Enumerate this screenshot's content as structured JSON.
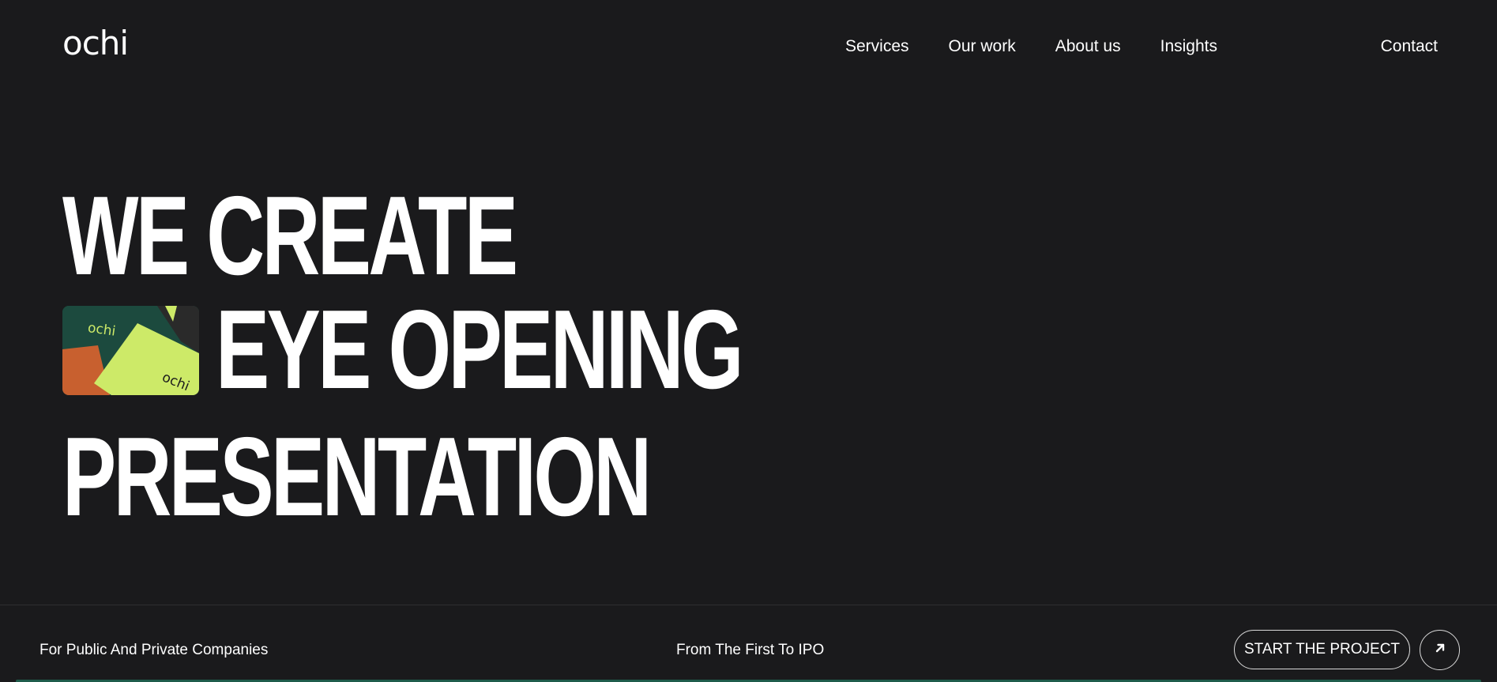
{
  "header": {
    "logo": "ochi",
    "nav": [
      "Services",
      "Our work",
      "About us",
      "Insights"
    ],
    "contact": "Contact"
  },
  "hero": {
    "line1": "WE CREATE",
    "line2": "EYE OPENING",
    "line3": "PRESENTATION",
    "image_logo_text": "ochi"
  },
  "footer_bar": {
    "tagline_left": "For Public And Private Companies",
    "tagline_center": "From The First To IPO",
    "cta_label": "START THE PROJECT",
    "cta_icon": "arrow-up-right-icon"
  },
  "colors": {
    "background": "#1a1a1c",
    "text": "#ffffff",
    "accent_green": "#cdea68",
    "dark_green": "#1c4a3e",
    "orange": "#c8602f"
  }
}
